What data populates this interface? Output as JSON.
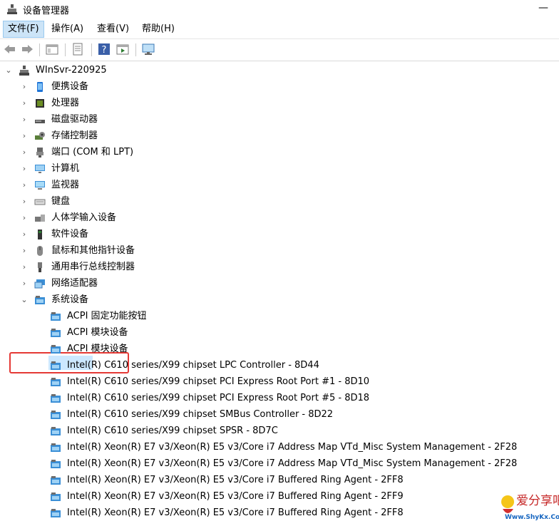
{
  "window": {
    "title": "设备管理器"
  },
  "menu": [
    {
      "label": "文件(F)"
    },
    {
      "label": "操作(A)"
    },
    {
      "label": "查看(V)"
    },
    {
      "label": "帮助(H)"
    }
  ],
  "tree": {
    "root": "WInSvr-220925",
    "categories": [
      {
        "label": "便携设备",
        "icon": "portable-device-icon"
      },
      {
        "label": "处理器",
        "icon": "processor-icon"
      },
      {
        "label": "磁盘驱动器",
        "icon": "disk-drive-icon"
      },
      {
        "label": "存储控制器",
        "icon": "storage-controller-icon"
      },
      {
        "label": "端口 (COM 和 LPT)",
        "icon": "port-icon"
      },
      {
        "label": "计算机",
        "icon": "computer-icon"
      },
      {
        "label": "监视器",
        "icon": "monitor-icon"
      },
      {
        "label": "键盘",
        "icon": "keyboard-icon"
      },
      {
        "label": "人体学输入设备",
        "icon": "hid-icon"
      },
      {
        "label": "软件设备",
        "icon": "software-device-icon"
      },
      {
        "label": "鼠标和其他指针设备",
        "icon": "mouse-icon"
      },
      {
        "label": "通用串行总线控制器",
        "icon": "usb-icon"
      },
      {
        "label": "网络适配器",
        "icon": "network-adapter-icon"
      }
    ],
    "expanded": {
      "label": "系统设备",
      "children": [
        "ACPI 固定功能按钮",
        "ACPI 模块设备",
        "ACPI 模块设备",
        "Intel(R) C610 series/X99 chipset LPC Controller - 8D44",
        "Intel(R) C610 series/X99 chipset PCI Express Root Port #1 - 8D10",
        "Intel(R) C610 series/X99 chipset PCI Express Root Port #5 - 8D18",
        "Intel(R) C610 series/X99 chipset SMBus Controller - 8D22",
        "Intel(R) C610 series/X99 chipset SPSR - 8D7C",
        "Intel(R) Xeon(R) E7 v3/Xeon(R) E5 v3/Core i7 Address Map VTd_Misc System Management - 2F28",
        "Intel(R) Xeon(R) E7 v3/Xeon(R) E5 v3/Core i7 Address Map VTd_Misc System Management - 2F28",
        "Intel(R) Xeon(R) E7 v3/Xeon(R) E5 v3/Core i7 Buffered Ring Agent - 2FF8",
        "Intel(R) Xeon(R) E7 v3/Xeon(R) E5 v3/Core i7 Buffered Ring Agent - 2FF9",
        "Intel(R) Xeon(R) E7 v3/Xeon(R) E5 v3/Core i7 Buffered Ring Agent - 2FF8"
      ]
    }
  },
  "watermark": {
    "text": "爱分享吧",
    "url_text": "Www.ShyKx.Com"
  }
}
